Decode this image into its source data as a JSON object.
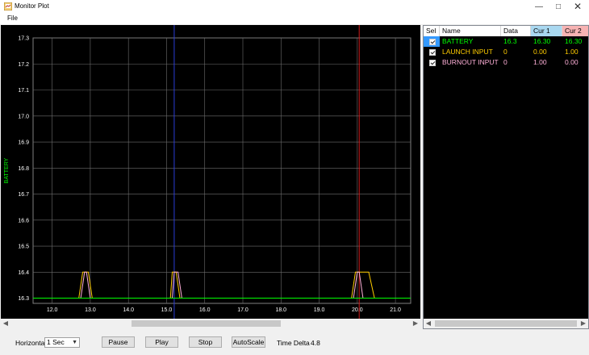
{
  "window": {
    "title": "Monitor Plot"
  },
  "menu": {
    "file": "File"
  },
  "chart_data": {
    "type": "line",
    "ylabel": "BATTERY",
    "xlim": [
      11.5,
      21.4
    ],
    "ylim": [
      16.28,
      17.3
    ],
    "x_ticks": [
      "12.0",
      "13.0",
      "14.0",
      "15.0",
      "16.0",
      "17.0",
      "18.0",
      "19.0",
      "20.0",
      "21.0"
    ],
    "y_ticks": [
      "17.3",
      "17.2",
      "17.1",
      "17.0",
      "16.9",
      "16.8",
      "16.7",
      "16.6",
      "16.5",
      "16.4",
      "16.3"
    ],
    "grid": true,
    "cursors": [
      {
        "name": "Cur 1",
        "x": 15.2,
        "color": "#2a3cd6"
      },
      {
        "name": "Cur 2",
        "x": 20.05,
        "color": "#d21c1c"
      }
    ],
    "series": [
      {
        "color": "#ffcc00",
        "points": [
          [
            11.5,
            16.3
          ],
          [
            12.7,
            16.3
          ],
          [
            12.8,
            16.4
          ],
          [
            12.95,
            16.4
          ],
          [
            13.05,
            16.3
          ],
          [
            15.1,
            16.3
          ],
          [
            15.15,
            16.4
          ],
          [
            15.25,
            16.4
          ],
          [
            15.35,
            16.3
          ],
          [
            19.85,
            16.3
          ],
          [
            19.95,
            16.4
          ],
          [
            20.3,
            16.4
          ],
          [
            20.45,
            16.3
          ],
          [
            21.4,
            16.3
          ]
        ]
      },
      {
        "color": "#ffb0d8",
        "points": [
          [
            11.5,
            16.3
          ],
          [
            12.75,
            16.3
          ],
          [
            12.85,
            16.4
          ],
          [
            12.9,
            16.4
          ],
          [
            13.0,
            16.3
          ],
          [
            15.15,
            16.3
          ],
          [
            15.2,
            16.4
          ],
          [
            15.3,
            16.4
          ],
          [
            15.4,
            16.3
          ],
          [
            19.9,
            16.3
          ],
          [
            20.0,
            16.4
          ],
          [
            20.05,
            16.4
          ],
          [
            20.15,
            16.3
          ],
          [
            21.4,
            16.3
          ]
        ]
      },
      {
        "color": "#00ff00",
        "points": [
          [
            11.5,
            16.3
          ],
          [
            21.4,
            16.3
          ]
        ]
      }
    ]
  },
  "list": {
    "headers": {
      "sel": "Sel",
      "name": "Name",
      "data": "Data",
      "cur1": "Cur 1",
      "cur2": "Cur 2"
    },
    "rows": [
      {
        "name": "BATTERY",
        "data": "16.3",
        "cur1": "16.30",
        "cur2": "16.30",
        "color": "#00ff00"
      },
      {
        "name": "LAUNCH INPUT",
        "data": "0",
        "cur1": "0.00",
        "cur2": "1.00",
        "color": "#ffcc00"
      },
      {
        "name": "BURNOUT INPUT",
        "data": "0",
        "cur1": "1.00",
        "cur2": "0.00",
        "color": "#ffb0d8"
      }
    ]
  },
  "controls": {
    "horizontal_label": "Horizontal",
    "horizontal_value": "1 Sec",
    "pause": "Pause",
    "play": "Play",
    "stop": "Stop",
    "autoscale": "AutoScale",
    "time_delta_label": "Time Delta",
    "time_delta_value": "4.8"
  }
}
